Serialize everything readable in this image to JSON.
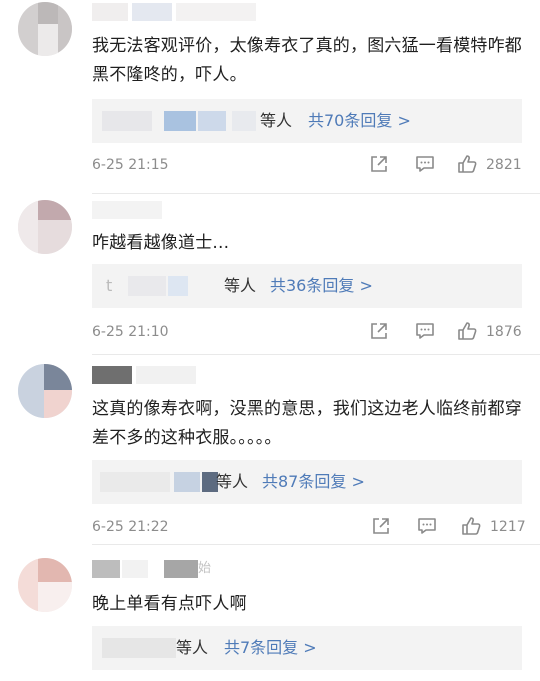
{
  "comments": [
    {
      "username_visible": "",
      "text": "我无法客观评价，太像寿衣了真的，图六猛一看模特咋都黑不隆咚的，吓人。",
      "reply": {
        "who_suffix": "等人",
        "link": "共70条回复 >"
      },
      "time": "6-25 21:15",
      "likes": "2821"
    },
    {
      "username_visible": "",
      "text": "咋越看越像道士...",
      "reply": {
        "who_prefix": "t",
        "who_suffix": "等人",
        "link": "共36条回复 >"
      },
      "time": "6-25 21:10",
      "likes": "1876"
    },
    {
      "username_visible": "",
      "text": "这真的像寿衣啊，没黑的意思，我们这边老人临终前都穿差不多的这种衣服。。。。。",
      "reply": {
        "who_suffix": "等人",
        "link": "共87条回复 >"
      },
      "time": "6-25 21:22",
      "likes": "1217"
    },
    {
      "username_visible": "始",
      "text": "晚上单看有点吓人啊",
      "reply": {
        "who_suffix": "等人",
        "link": "共7条回复 >"
      }
    }
  ],
  "icons": {
    "forward": "share-icon",
    "comment": "comment-icon",
    "like": "thumbs-up-icon"
  },
  "colors": {
    "link": "#4f7bb8",
    "meta": "#8c8c8c",
    "reply_bg": "#f3f3f3"
  }
}
